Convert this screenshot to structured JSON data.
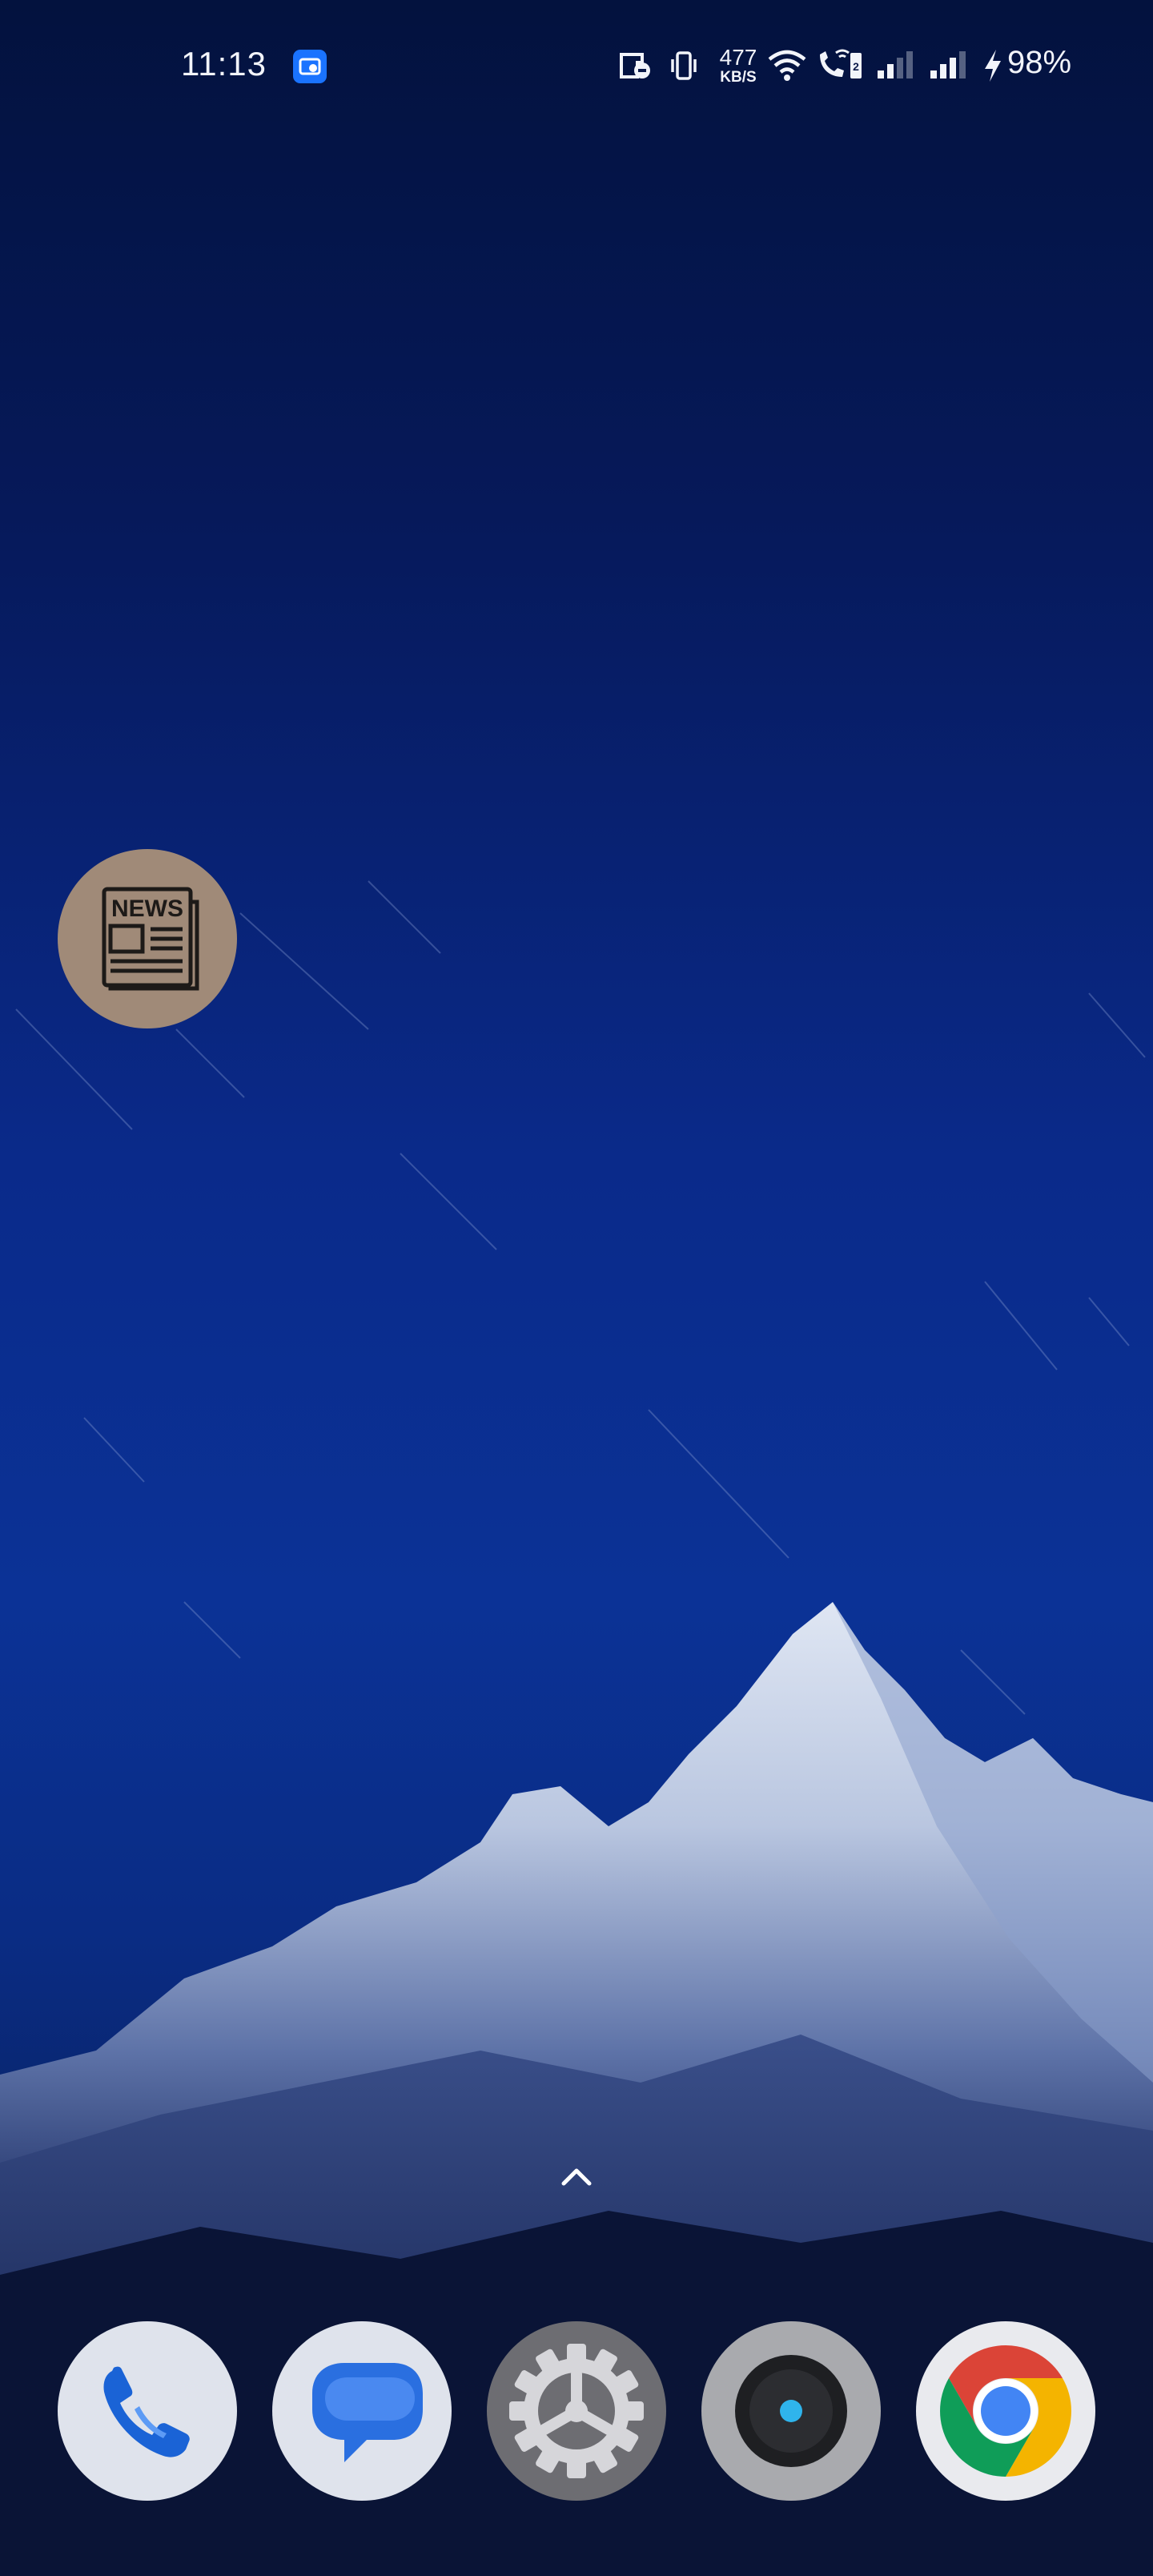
{
  "status_bar": {
    "time": "11:13",
    "network_speed_value": "477",
    "network_speed_unit": "KB/S",
    "battery_percent": "98%",
    "icons": [
      "notification-app-icon",
      "data-saver-icon",
      "vibrate-icon",
      "wifi-icon",
      "wifi-calling-icon",
      "signal-sim1-icon",
      "signal-sim2-icon",
      "charging-icon"
    ]
  },
  "home_screen": {
    "shortcut": {
      "icon_text": "NEWS",
      "icon": "newspaper-icon",
      "background_color": "#a08a78"
    },
    "swipe_up_indicator": "chevron-up-icon"
  },
  "dock": {
    "apps": [
      {
        "name": "Phone",
        "icon": "phone-icon"
      },
      {
        "name": "Messages",
        "icon": "messages-icon"
      },
      {
        "name": "Settings",
        "icon": "settings-icon"
      },
      {
        "name": "Camera",
        "icon": "camera-icon"
      },
      {
        "name": "Chrome",
        "icon": "chrome-icon"
      }
    ]
  },
  "colors": {
    "accent_blue": "#1a73ff",
    "wallpaper_top": "#03123e",
    "wallpaper_mid": "#0b3296",
    "chrome_red": "#db4437",
    "chrome_yellow": "#f4b400",
    "chrome_green": "#0f9d58",
    "chrome_blue": "#4285f4"
  }
}
